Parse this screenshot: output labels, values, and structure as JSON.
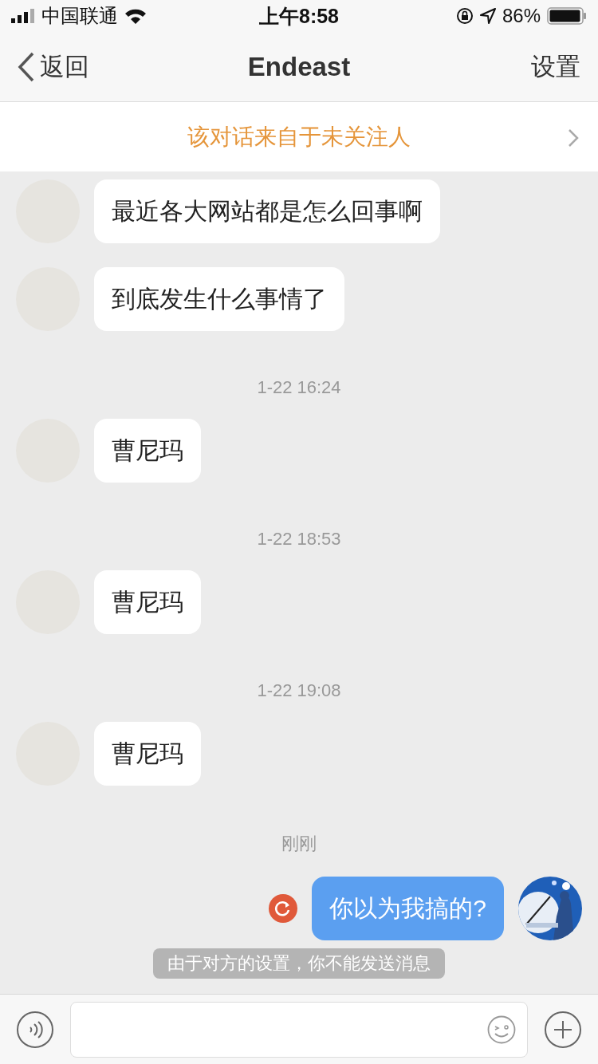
{
  "status_bar": {
    "carrier": "中国联通",
    "time": "上午8:58",
    "battery": "86%"
  },
  "nav": {
    "back": "返回",
    "title": "Endeast",
    "settings": "设置"
  },
  "banner": {
    "text": "该对话来自于未关注人"
  },
  "messages": [
    {
      "kind": "received",
      "text": "最近各大网站都是怎么回事啊"
    },
    {
      "kind": "received",
      "text": "到底发生什么事情了"
    },
    {
      "kind": "time",
      "text": "1-22 16:24"
    },
    {
      "kind": "received",
      "text": "曹尼玛"
    },
    {
      "kind": "time",
      "text": "1-22 18:53"
    },
    {
      "kind": "received",
      "text": "曹尼玛"
    },
    {
      "kind": "time",
      "text": "1-22 19:08"
    },
    {
      "kind": "received",
      "text": "曹尼玛"
    },
    {
      "kind": "time",
      "text": "刚刚"
    },
    {
      "kind": "sent",
      "text": "你以为我搞的?",
      "failed": true
    }
  ],
  "notice": {
    "text": "由于对方的设置，你不能发送消息"
  }
}
